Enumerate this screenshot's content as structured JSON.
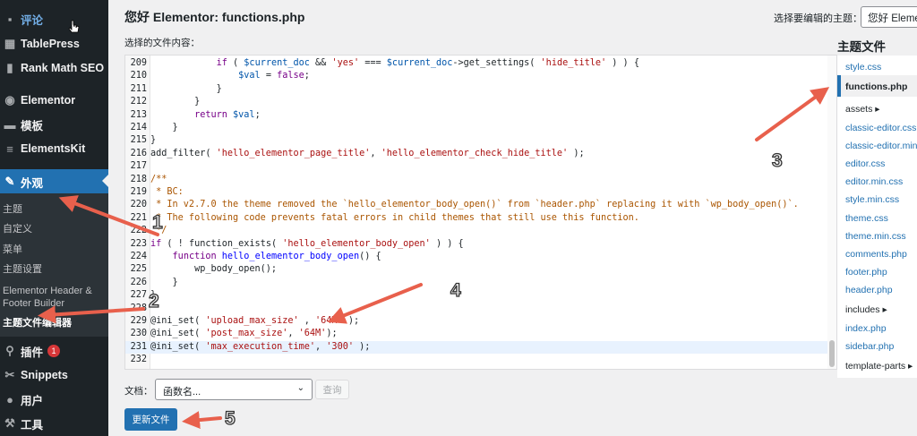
{
  "sidebar": {
    "items": [
      {
        "label": "评论",
        "icon": "comment-icon",
        "glyph": "▪"
      },
      {
        "label": "TablePress",
        "icon": "table-icon",
        "glyph": "▦"
      },
      {
        "label": "Rank Math SEO",
        "icon": "chart-icon",
        "glyph": "▮"
      },
      {
        "label": "Elementor",
        "icon": "elementor-icon",
        "glyph": "◉"
      },
      {
        "label": "模板",
        "icon": "folder-icon",
        "glyph": "▬"
      },
      {
        "label": "ElementsKit",
        "icon": "elementskit-icon",
        "glyph": "≡"
      },
      {
        "label": "外观",
        "icon": "paintbrush-icon",
        "glyph": "✎"
      },
      {
        "label": "插件",
        "icon": "plugin-icon",
        "glyph": "⚲",
        "badge": "1"
      },
      {
        "label": "Snippets",
        "icon": "snippets-icon",
        "glyph": "✂"
      },
      {
        "label": "用户",
        "icon": "user-icon",
        "glyph": "●"
      },
      {
        "label": "工具",
        "icon": "wrench-icon",
        "glyph": "⚒"
      }
    ],
    "submenu": [
      "主题",
      "自定义",
      "菜单",
      "主题设置",
      "Elementor Header &",
      "Footer Builder",
      "主题文件编辑器"
    ]
  },
  "header": {
    "title": "您好 Elementor: functions.php",
    "choose_theme_label": "选择要编辑的主题：",
    "theme_select_value": "您好 Elementor"
  },
  "editor": {
    "file_label": "选择的文件内容：",
    "lines": [
      {
        "n": "209",
        "html": "            <span class=\"kw\">if</span> ( <span class=\"var\">$current_doc</span> &amp;&amp; <span class=\"str\">'yes'</span> === <span class=\"var\">$current_doc</span>-&gt;get_settings( <span class=\"str\">'hide_title'</span> ) ) {"
      },
      {
        "n": "210",
        "html": "                <span class=\"var\">$val</span> = <span class=\"kw\">false</span>;"
      },
      {
        "n": "211",
        "html": "            }"
      },
      {
        "n": "212",
        "html": "        }"
      },
      {
        "n": "213",
        "html": "        <span class=\"kw\">return</span> <span class=\"var\">$val</span>;"
      },
      {
        "n": "214",
        "html": "    }"
      },
      {
        "n": "215",
        "html": "}"
      },
      {
        "n": "216",
        "html": "add_filter( <span class=\"str\">'hello_elementor_page_title'</span>, <span class=\"str\">'hello_elementor_check_hide_title'</span> );"
      },
      {
        "n": "217",
        "html": ""
      },
      {
        "n": "218",
        "html": "<span class=\"cm\">/**</span>"
      },
      {
        "n": "219",
        "html": "<span class=\"cm\"> * BC:</span>"
      },
      {
        "n": "220",
        "html": "<span class=\"cm\"> * In v2.7.0 the theme removed the `hello_elementor_body_open()` from `header.php` replacing it with `wp_body_open()`.</span>"
      },
      {
        "n": "221",
        "html": "<span class=\"cm\"> * The following code prevents fatal errors in child themes that still use this function.</span>"
      },
      {
        "n": "222",
        "html": "<span class=\"cm\"> */</span>"
      },
      {
        "n": "223",
        "html": "<span class=\"kw\">if</span> ( ! function_exists( <span class=\"str\">'hello_elementor_body_open'</span> ) ) {"
      },
      {
        "n": "224",
        "html": "    <span class=\"kw\">function</span> <span class=\"def\">hello_elementor_body_open</span>() {"
      },
      {
        "n": "225",
        "html": "        wp_body_open();"
      },
      {
        "n": "226",
        "html": "    }"
      },
      {
        "n": "227",
        "html": "}"
      },
      {
        "n": "228",
        "html": ""
      },
      {
        "n": "229",
        "html": "@ini_set( <span class=\"str\">'upload_max_size'</span> , <span class=\"str\">'64M'</span> );"
      },
      {
        "n": "230",
        "html": "@ini_set( <span class=\"str\">'post_max_size'</span>, <span class=\"str\">'64M'</span>);"
      },
      {
        "n": "231",
        "html": "@ini_set( <span class=\"str\">'max_execution_time'</span>, <span class=\"str\">'300'</span> );"
      },
      {
        "n": "232",
        "html": ""
      }
    ],
    "active_line": "231"
  },
  "files": {
    "title": "主题文件",
    "items": [
      {
        "label": "style.css",
        "type": "file"
      },
      {
        "label": "functions.php",
        "type": "current"
      },
      {
        "label": "assets ▸",
        "type": "folder"
      },
      {
        "label": "classic-editor.css",
        "type": "file"
      },
      {
        "label": "classic-editor.min.css",
        "type": "file"
      },
      {
        "label": "editor.css",
        "type": "file"
      },
      {
        "label": "editor.min.css",
        "type": "file"
      },
      {
        "label": "style.min.css",
        "type": "file"
      },
      {
        "label": "theme.css",
        "type": "file"
      },
      {
        "label": "theme.min.css",
        "type": "file"
      },
      {
        "label": "comments.php",
        "type": "file"
      },
      {
        "label": "footer.php",
        "type": "file"
      },
      {
        "label": "header.php",
        "type": "file"
      },
      {
        "label": "includes ▸",
        "type": "folder"
      },
      {
        "label": "index.php",
        "type": "file"
      },
      {
        "label": "sidebar.php",
        "type": "file"
      },
      {
        "label": "template-parts ▸",
        "type": "folder"
      }
    ]
  },
  "footer": {
    "doc_label": "文档：",
    "doc_select_value": "函数名...",
    "lookup_label": "查询",
    "update_label": "更新文件"
  },
  "annotations": [
    "1",
    "2",
    "3",
    "4",
    "5"
  ],
  "colors": {
    "sidebar_bg": "#1d2327",
    "accent": "#2271b1",
    "arrow": "#e8604c"
  }
}
